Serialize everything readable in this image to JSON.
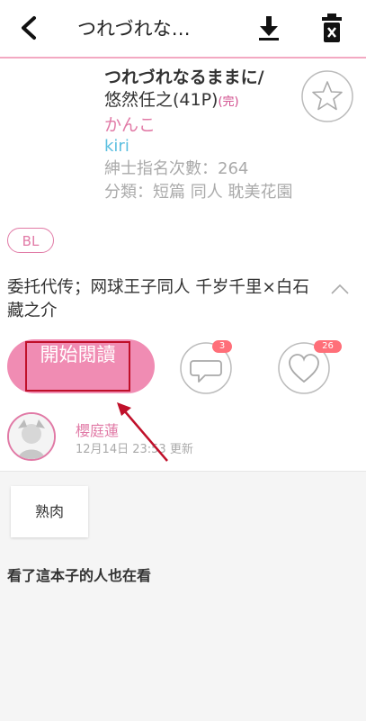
{
  "header": {
    "title": "つれづれな…"
  },
  "book": {
    "title": "つれづれなるままに/",
    "subtitle": "悠然任之(41P)",
    "complete_tag": "(完)",
    "author": "かんこ",
    "translator": "kiri",
    "rank": "紳士指名次數：264",
    "category": "分類：短篇 同人 耽美花園",
    "tag": "BL",
    "description": "委托代传；网球王子同人 千岁千里×白石藏之介"
  },
  "actions": {
    "read_label": "開始閱讀",
    "comment_count": "3",
    "like_count": "26"
  },
  "uploader": {
    "name": "櫻庭蓮",
    "updated": "12月14日 23:53 更新"
  },
  "tags": [
    "熟肉"
  ],
  "section": {
    "title": "看了這本子的人也在看"
  },
  "colors": {
    "accent": "#f08cb3",
    "author": "#e17aa6",
    "translator": "#5bbfe0",
    "badge": "#ff6f79"
  }
}
